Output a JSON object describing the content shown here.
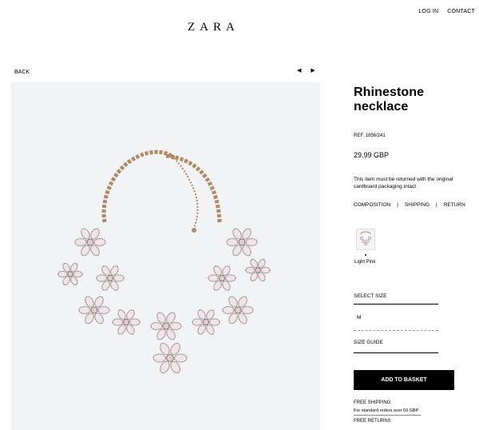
{
  "header": {
    "brand": "ZARA",
    "login_label": "LOG IN",
    "contact_label": "CONTACT"
  },
  "nav": {
    "back_label": "BACK",
    "prev_symbol": "◀",
    "next_symbol": "▶"
  },
  "product": {
    "title": "Rhinestone necklace",
    "ref": "REF. 1856/241",
    "price": "29.99 GBP",
    "return_note": "This item must be returned with the original cardboard packaging intact",
    "links": [
      "COMPOSITION",
      "SHIPPING",
      "RETURN"
    ],
    "link_separator": "|",
    "color_name": "Light Pink",
    "select_size_label": "SELECT SIZE",
    "selected_size": "M",
    "size_guide_label": "SIZE GUIDE",
    "add_to_basket_label": "ADD TO BASKET",
    "free_shipping_label": "FREE SHIPPING",
    "shipping_note": "For standard orders over 50 GBP",
    "free_returns_label": "FREE RETURNS"
  },
  "colors": {
    "image_background": "#f2f3f5",
    "chain": "#b08a66",
    "stone": "#f3e4e8",
    "setting": "#7d7a78",
    "button_bg": "#000000",
    "button_text": "#ffffff"
  }
}
